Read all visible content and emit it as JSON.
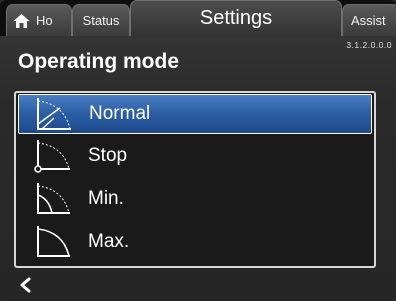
{
  "tabs": {
    "home_label": "Ho",
    "status_label": "Status",
    "settings_label": "Settings",
    "assist_label": "Assist"
  },
  "version": "3.1.2.0.0.0",
  "page_title": "Operating mode",
  "modes": [
    {
      "label": "Normal",
      "icon": "normal-curve-icon",
      "selected": true
    },
    {
      "label": "Stop",
      "icon": "stop-curve-icon",
      "selected": false
    },
    {
      "label": "Min.",
      "icon": "min-curve-icon",
      "selected": false
    },
    {
      "label": "Max.",
      "icon": "max-curve-icon",
      "selected": false
    }
  ],
  "footer": {
    "back_icon": "chevron-left-icon"
  },
  "colors": {
    "selection": "#2d5fa6",
    "background": "#262626",
    "tab_bar": "#0e0e0e"
  }
}
